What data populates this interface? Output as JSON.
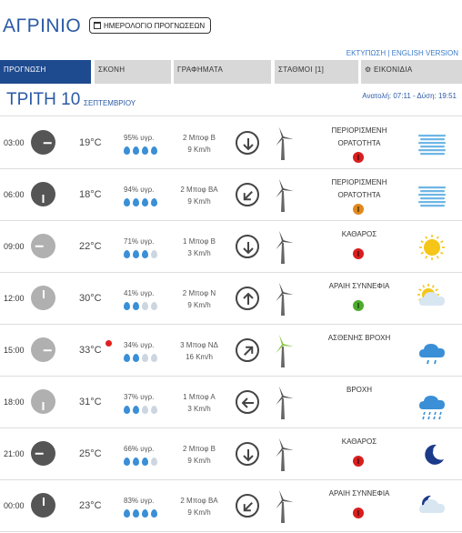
{
  "header": {
    "city": "ΑΓΡΙΝΙΟ",
    "calendar_button": "ΗΜΕΡΟΛΟΓΙΟ ΠΡΟΓΝΩΣΕΩΝ",
    "print_link": "ΕΚΤΥΠΩΣΗ | ENGLISH VERSION"
  },
  "tabs": [
    "ΠΡΟΓΝΩΣΗ",
    "ΣΚΟΝΗ",
    "ΓΡΑΦΗΜΑΤΑ",
    "ΣΤΑΘΜΟΙ [1]",
    "⚙ ΕΙΚΟΝΙΔΙΑ"
  ],
  "day": {
    "name": "ΤΡΙΤΗ 10",
    "month": "ΣΕΠΤΕΜΒΡΙΟΥ",
    "sun": "Ανατολή: 07:11 - Δύση: 19:51"
  },
  "colors": {
    "accent": "#2b5aa6",
    "tab_active": "#1e4a8f",
    "drop": "#3a8fd6",
    "alert": "#e02020"
  },
  "rows": [
    {
      "time": "03:00",
      "clock": "dark",
      "temp": "19°C",
      "hum": "95% υγρ.",
      "drops": 4,
      "bf": "2 Μποφ Β",
      "kmh": "9 Km/h",
      "wind_dir_deg": 180,
      "cond": "ΠΕΡΙΟΡΙΣΜΕΝΗ ΟΡΑΤΟΤΗΤΑ",
      "vis": "red",
      "icon": "fog-icon"
    },
    {
      "time": "06:00",
      "clock": "dark",
      "temp": "18°C",
      "hum": "94% υγρ.",
      "drops": 4,
      "bf": "2 Μποφ ΒΑ",
      "kmh": "9 Km/h",
      "wind_dir_deg": 225,
      "cond": "ΠΕΡΙΟΡΙΣΜΕΝΗ ΟΡΑΤΟΤΗΤΑ",
      "vis": "orange",
      "icon": "fog-icon"
    },
    {
      "time": "09:00",
      "clock": "light",
      "temp": "22°C",
      "hum": "71% υγρ.",
      "drops": 3,
      "bf": "1 Μποφ Β",
      "kmh": "3 Km/h",
      "wind_dir_deg": 180,
      "cond": "ΚΑΘΑΡΟΣ",
      "vis": "red",
      "icon": "sun-icon"
    },
    {
      "time": "12:00",
      "clock": "light",
      "temp": "30°C",
      "hum": "41% υγρ.",
      "drops": 2,
      "bf": "2 Μποφ Ν",
      "kmh": "9 Km/h",
      "wind_dir_deg": 0,
      "cond": "ΑΡΑΙΗ ΣΥΝΝΕΦΙΑ",
      "vis": "green",
      "icon": "sun-cloud-icon"
    },
    {
      "time": "15:00",
      "clock": "light",
      "temp": "33°C",
      "alert": true,
      "hum": "34% υγρ.",
      "drops": 2,
      "bf": "3 Μποφ ΝΔ",
      "kmh": "16 Km/h",
      "wind_dir_deg": 45,
      "cond": "ΑΣΘΕΝΗΣ ΒΡΟΧΗ",
      "vis": "",
      "icon": "light-rain-icon"
    },
    {
      "time": "18:00",
      "clock": "light",
      "temp": "31°C",
      "hum": "37% υγρ.",
      "drops": 2,
      "bf": "1 Μποφ Α",
      "kmh": "3 Km/h",
      "wind_dir_deg": 270,
      "cond": "ΒΡΟΧΗ",
      "vis": "",
      "icon": "rain-icon"
    },
    {
      "time": "21:00",
      "clock": "dark",
      "temp": "25°C",
      "hum": "66% υγρ.",
      "drops": 3,
      "bf": "2 Μποφ Β",
      "kmh": "9 Km/h",
      "wind_dir_deg": 180,
      "cond": "ΚΑΘΑΡΟΣ",
      "vis": "red",
      "icon": "moon-icon"
    },
    {
      "time": "00:00",
      "clock": "dark",
      "temp": "23°C",
      "hum": "83% υγρ.",
      "drops": 4,
      "bf": "2 Μποφ ΒΑ",
      "kmh": "9 Km/h",
      "wind_dir_deg": 225,
      "cond": "ΑΡΑΙΗ ΣΥΝΝΕΦΙΑ",
      "vis": "red",
      "icon": "moon-cloud-icon"
    }
  ]
}
